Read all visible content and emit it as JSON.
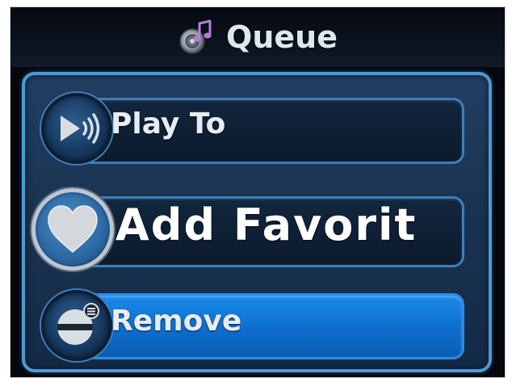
{
  "header": {
    "title": "Queue",
    "icon": "music-speaker-icon"
  },
  "menu": {
    "items": [
      {
        "label": "Play To",
        "icon": "speaker-volume-icon",
        "state": "normal"
      },
      {
        "label": "Add Favorit",
        "icon": "heart-icon",
        "state": "focused"
      },
      {
        "label": "Remove",
        "icon": "remove-minus-icon",
        "state": "selected"
      }
    ]
  },
  "colors": {
    "accent_border": "#4a9ad6",
    "selected_fill": "#1a8ae8",
    "panel_fill": "#1a3352",
    "text": "#e7ecf2"
  }
}
